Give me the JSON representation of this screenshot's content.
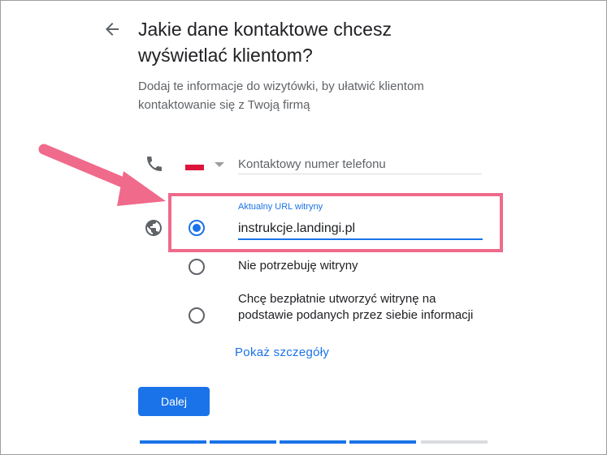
{
  "header": {
    "back_label": "Wstecz",
    "title": "Jakie dane kontaktowe chcesz wyświetlać klientom?",
    "subtitle": "Dodaj te informacje do wizytówki, by ułatwić klientom kontaktowanie się z Twoją firmą"
  },
  "phone": {
    "icon": "phone-icon",
    "country": "Polska",
    "placeholder": "Kontaktowy numer telefonu",
    "value": ""
  },
  "website": {
    "icon": "globe-icon",
    "options": [
      {
        "field_label": "Aktualny URL witryny",
        "value": "instrukcje.landingi.pl",
        "selected": true
      },
      {
        "label": "Nie potrzebuję witryny",
        "selected": false
      },
      {
        "label": "Chcę bezpłatnie utworzyć witrynę na podstawie podanych przez siebie informacji",
        "selected": false
      }
    ],
    "details_link": "Pokaż szczegóły"
  },
  "actions": {
    "next_label": "Dalej"
  },
  "progress": {
    "steps_total": 5,
    "steps_done": 4
  },
  "colors": {
    "accent": "#1a73e8",
    "highlight": "#f06a8b"
  }
}
